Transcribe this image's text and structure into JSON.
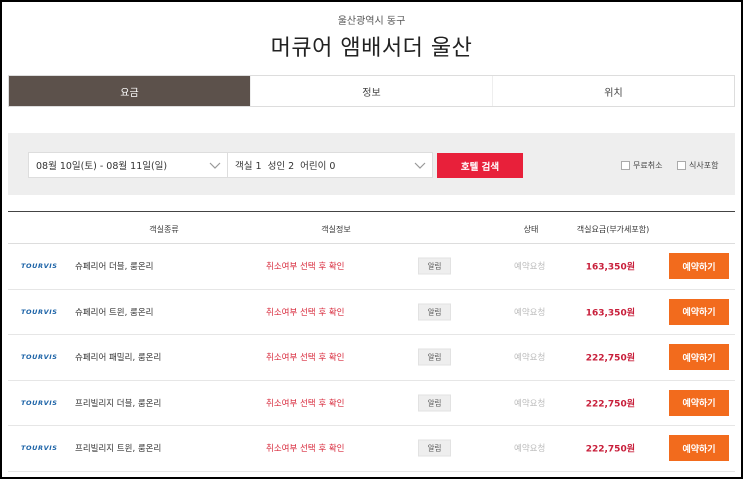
{
  "header": {
    "location": "울산광역시 동구",
    "hotel_name": "머큐어 앰배서더 울산"
  },
  "tabs": [
    {
      "label": "요금",
      "active": true
    },
    {
      "label": "정보",
      "active": false
    },
    {
      "label": "위치",
      "active": false
    }
  ],
  "search": {
    "date_range": "08월 10일(토) - 08월 11일(일)",
    "room_guests": "객실 1  성인 2  어린이 0",
    "search_button": "호텔 검색",
    "free_cancel_label": "무료취소",
    "meal_label": "식사포함"
  },
  "table": {
    "headers": {
      "room_type": "객실종류",
      "room_info": "객실정보",
      "status": "상태",
      "price": "객실요금(부가세포함)"
    },
    "rows": [
      {
        "provider": "TOURVIS",
        "room": "슈페리어 더블, 룸온리",
        "cancel": "취소여부 선택 후 확인",
        "notice": "알림",
        "status": "예약요청",
        "price": "163,350원",
        "book": "예약하기"
      },
      {
        "provider": "TOURVIS",
        "room": "슈페리어 트윈, 룸온리",
        "cancel": "취소여부 선택 후 확인",
        "notice": "알림",
        "status": "예약요청",
        "price": "163,350원",
        "book": "예약하기"
      },
      {
        "provider": "TOURVIS",
        "room": "슈페리어 패밀리, 룸온리",
        "cancel": "취소여부 선택 후 확인",
        "notice": "알림",
        "status": "예약요청",
        "price": "222,750원",
        "book": "예약하기"
      },
      {
        "provider": "TOURVIS",
        "room": "프리빌리지 더블, 룸온리",
        "cancel": "취소여부 선택 후 확인",
        "notice": "알림",
        "status": "예약요청",
        "price": "222,750원",
        "book": "예약하기"
      },
      {
        "provider": "TOURVIS",
        "room": "프리빌리지 트윈, 룸온리",
        "cancel": "취소여부 선택 후 확인",
        "notice": "알림",
        "status": "예약요청",
        "price": "222,750원",
        "book": "예약하기"
      }
    ]
  },
  "colors": {
    "active_tab": "#5c514b",
    "search_button": "#e8203a",
    "book_button": "#f26b1d",
    "price": "#c81e3a",
    "cancel_text": "#d82a3c",
    "provider_logo": "#1c63a7"
  }
}
